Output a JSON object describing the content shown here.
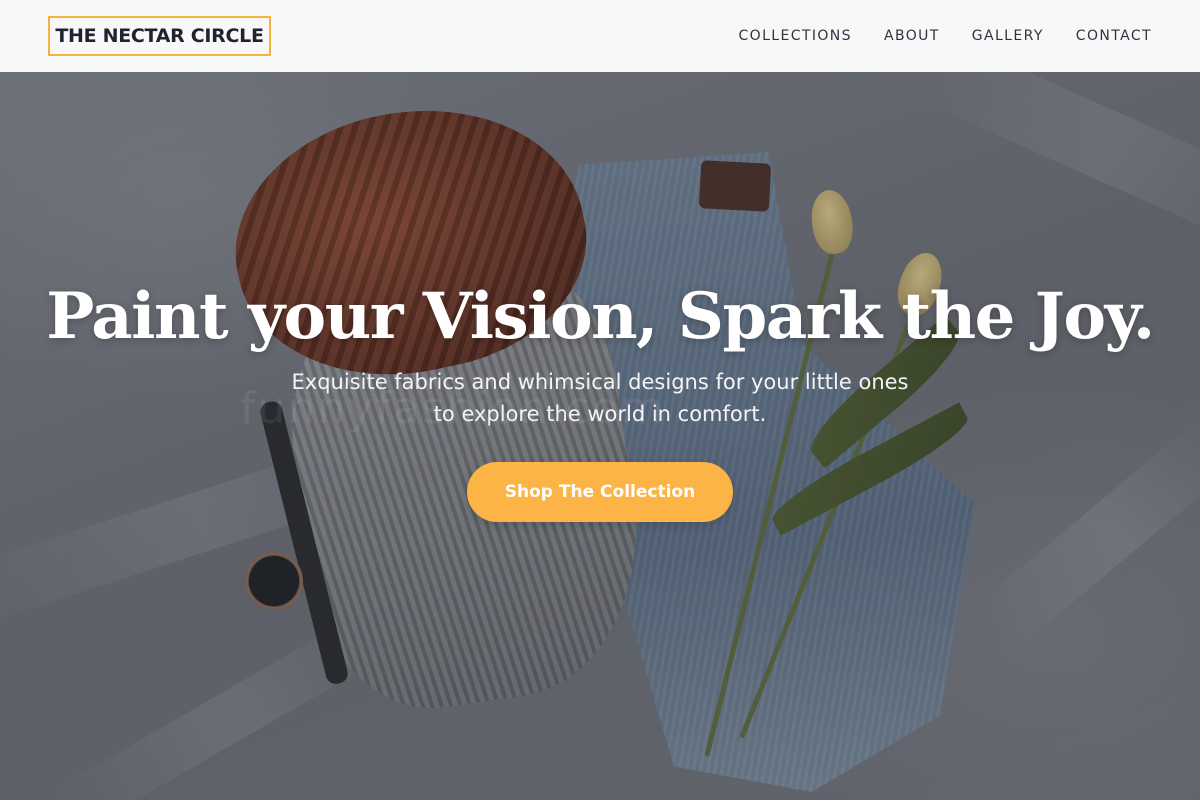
{
  "header": {
    "logo_text": "THE NECTAR CIRCLE",
    "nav": [
      {
        "label": "COLLECTIONS"
      },
      {
        "label": "ABOUT"
      },
      {
        "label": "GALLERY"
      },
      {
        "label": "CONTACT"
      }
    ]
  },
  "hero": {
    "headline": "Paint your Vision, Spark the Joy.",
    "subtitle": "Exquisite fabrics and whimsical designs for your little ones to explore the world in comfort.",
    "cta_label": "Shop The Collection",
    "watermark": "funnyfashion.com"
  },
  "colors": {
    "accent": "#fdb446",
    "logo_border": "#f5b342",
    "header_bg": "#f8f8f8",
    "nav_text": "#2f3340",
    "hero_text": "#ffffff"
  }
}
